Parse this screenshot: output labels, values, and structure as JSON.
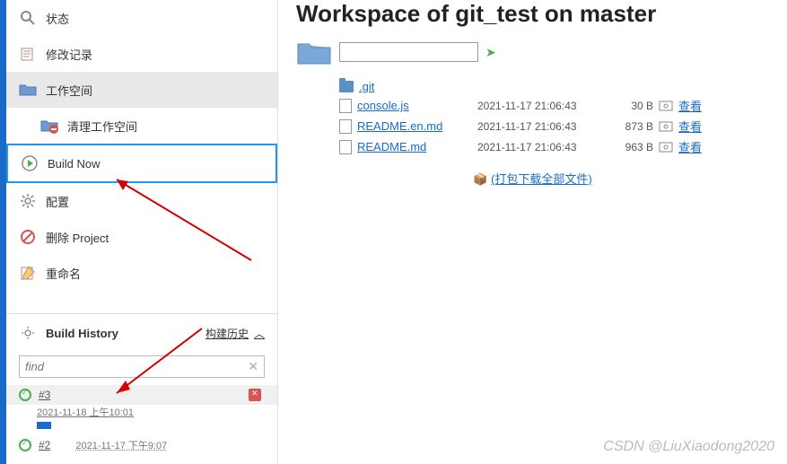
{
  "sidebar": {
    "items": [
      {
        "label": "状态",
        "name": "menu-status"
      },
      {
        "label": "修改记录",
        "name": "menu-changes"
      },
      {
        "label": "工作空间",
        "name": "menu-workspace",
        "selected": true
      },
      {
        "label": "清理工作空间",
        "name": "menu-clean-workspace",
        "indented": true
      },
      {
        "label": "Build Now",
        "name": "menu-build-now",
        "highlight": true
      },
      {
        "label": "配置",
        "name": "menu-configure"
      },
      {
        "label": "删除 Project",
        "name": "menu-delete-project"
      },
      {
        "label": "重命名",
        "name": "menu-rename"
      }
    ]
  },
  "history": {
    "title": "Build History",
    "link_label": "构建历史",
    "find_placeholder": "find",
    "builds": [
      {
        "id": "#3",
        "time": "2021-11-18 上午10:01",
        "active": true,
        "running": true
      },
      {
        "id": "#2",
        "time": "2021-11-17 下午9:07",
        "active": false
      }
    ]
  },
  "main": {
    "title": "Workspace of git_test on master",
    "files": [
      {
        "type": "folder",
        "name": ".git"
      },
      {
        "type": "file",
        "name": "console.js",
        "date": "2021-11-17 21:06:43",
        "size": "30 B",
        "view": "查看"
      },
      {
        "type": "file",
        "name": "README.en.md",
        "date": "2021-11-17 21:06:43",
        "size": "873 B",
        "view": "查看"
      },
      {
        "type": "file",
        "name": "README.md",
        "date": "2021-11-17 21:06:43",
        "size": "963 B",
        "view": "查看"
      }
    ],
    "download_all": "(打包下载全部文件)"
  },
  "watermark": "CSDN @LiuXiaodong2020"
}
